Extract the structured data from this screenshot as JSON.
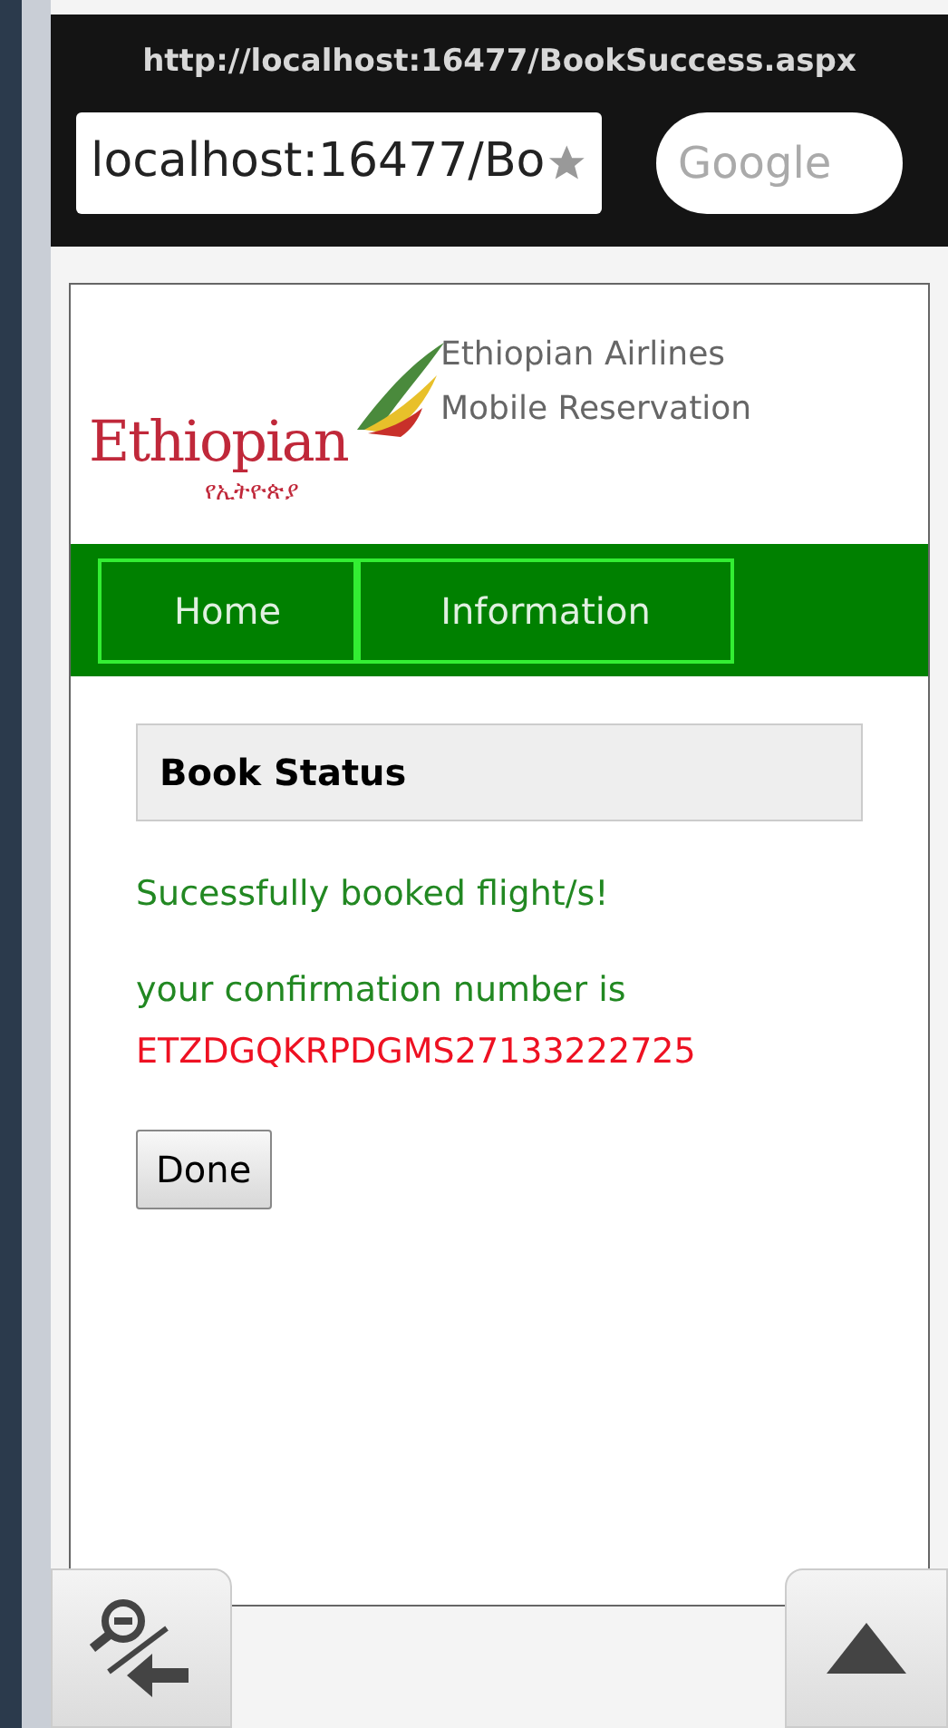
{
  "browser": {
    "title": "http://localhost:16477/BookSuccess.aspx",
    "address": "localhost:16477/Bo",
    "search_placeholder": "Google"
  },
  "logo": {
    "wordmark": "Ethiopian",
    "script": "የኢትዮጵያ"
  },
  "header": {
    "line_1": "Ethiopian Airlines",
    "line_2": "Mobile Reservation"
  },
  "nav": [
    {
      "label": "Home"
    },
    {
      "label": "Information"
    }
  ],
  "panel": {
    "title": "Book Status",
    "success": "Sucessfully booked flight/s!",
    "confirmation_label": "your confirmation number is",
    "confirmation_number": "ETZDGQKRPDGMS27133222725",
    "button": "Done"
  }
}
